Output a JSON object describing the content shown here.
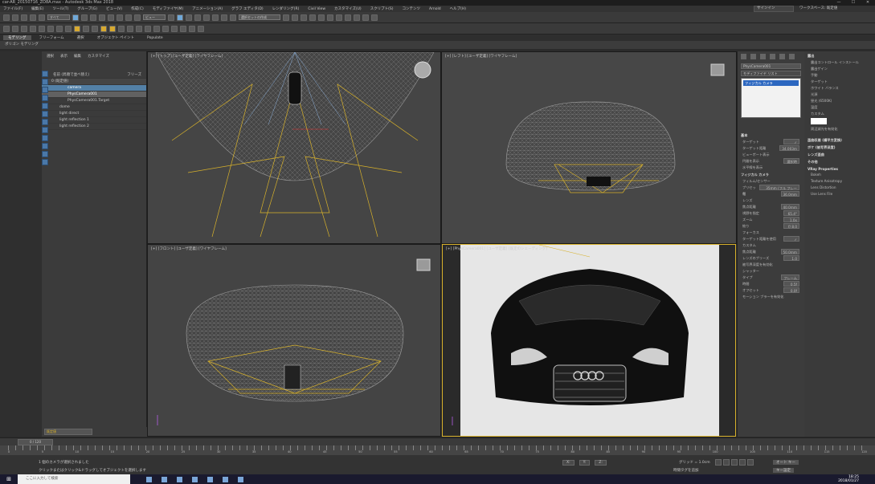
{
  "title_bar": {
    "title": "car-AR_20150716_ZO8A.max - Autodesk 3ds Max 2018",
    "min": "—",
    "max": "☐",
    "close": "✕"
  },
  "menu": {
    "items": [
      "ファイル(F)",
      "編集(E)",
      "ツール(T)",
      "グループ(G)",
      "ビュー(V)",
      "作成(C)",
      "モディファイヤ(M)",
      "アニメーション(A)",
      "グラフ エディタ(D)",
      "レンダリング(R)",
      "Civil View",
      "カスタマイズ(U)",
      "スクリプト(S)",
      "コンテンツ",
      "Arnold",
      "ヘルプ(H)"
    ],
    "signin": "サインイン",
    "workspace": "ワークスペース: 既定値"
  },
  "toolbar1": {
    "selection_filter": "すべて",
    "view_select": "ビュー",
    "named_sel": "選択セットの作成"
  },
  "ribbon": {
    "tabs": [
      "モデリング",
      "フリーフォーム",
      "選択",
      "オブジェクト ペイント",
      "Populate"
    ],
    "sub": "ポリゴン モデリング"
  },
  "scene_explorer": {
    "tabs": [
      "選択",
      "表示",
      "編集",
      "カスタマイズ"
    ],
    "header": "名前 (昇順で並べ替え)",
    "freeze": "フリーズ",
    "rows": [
      {
        "name": "0 (既定値)",
        "sel": false,
        "hdr": true
      },
      {
        "name": "camera",
        "sel": true,
        "hdr": false
      },
      {
        "name": "PhysCamera001",
        "sel": false,
        "hdr": false
      },
      {
        "name": "PhysCamera001.Target",
        "sel": false,
        "hdr": false
      },
      {
        "name": "dome",
        "sel": false,
        "hdr": false
      },
      {
        "name": "light direct",
        "sel": false,
        "hdr": false
      },
      {
        "name": "light reflection 1",
        "sel": false,
        "hdr": false
      },
      {
        "name": "light reflection 2",
        "sel": false,
        "hdr": false
      }
    ],
    "bottom_select": "既定値"
  },
  "viewports": {
    "top": "[+] [トップ] [ユーザ定義] [ワイヤフレーム]",
    "left": "[+] [レフト] [ユーザ定義] [ワイヤフレーム]",
    "front": "[+] [フロント] [ユーザ定義] [ワイヤフレーム]",
    "camera": "[+] [PhysCamera001] [ユーザ定義] [既定のシェーディング]"
  },
  "command_panel": {
    "object_name": "PhysCamera001",
    "modifier_list": "モディファイヤ リスト",
    "stack_item": "フィジカル カメラ",
    "sections": [
      {
        "title": "基本",
        "props": [
          [
            "ターゲット",
            "✓"
          ],
          [
            "ターゲット距離",
            "34.003m"
          ],
          [
            "ビューポート表示",
            ""
          ],
          [
            "円錐を表示",
            "選択時"
          ],
          [
            "水平線を表示",
            ""
          ]
        ]
      },
      {
        "title": "フィジカル カメラ",
        "props": [
          [
            "フィルム/センサー",
            ""
          ],
          [
            "プリセット",
            "35mm (フル フレーム)"
          ],
          [
            "幅",
            "36.0mm"
          ],
          [
            "レンズ",
            ""
          ],
          [
            "焦点距離",
            "40.0mm"
          ],
          [
            "視野を指定",
            "65.4°"
          ],
          [
            "ズーム",
            "1.0x"
          ],
          [
            "絞り",
            "f/ 8.0"
          ],
          [
            "フォーカス",
            ""
          ],
          [
            "ターゲット距離を使用",
            "✓"
          ],
          [
            "カスタム",
            ""
          ],
          [
            "焦点距離",
            "50.0mm"
          ],
          [
            "レンズのブリーズ",
            "1.0"
          ],
          [
            "被写界深度を有効化",
            ""
          ],
          [
            "シャッター",
            ""
          ],
          [
            "タイプ",
            "フレーム"
          ],
          [
            "時間",
            "0.5f"
          ],
          [
            "オフセット",
            "0.0f"
          ],
          [
            "モーション ブラーを有効化",
            ""
          ]
        ]
      }
    ]
  },
  "props_right": {
    "sections": [
      {
        "title": "露出",
        "props": [
          "露出コントロール インストール",
          "露出ゲイン",
          "手動",
          "ターゲット",
          "ホワイト バランス",
          "光源",
          "昼光 (6500K)",
          "温度",
          "カスタム",
          "周辺減光を有効化"
        ]
      },
      {
        "title": "歪曲収差 (横平方変換)",
        "props": []
      },
      {
        "title": "ボケ (被写界深度)",
        "props": []
      },
      {
        "title": "レンズ歪曲",
        "props": []
      },
      {
        "title": "その他",
        "props": []
      },
      {
        "title": "VRay Properties",
        "props": [
          "Bokeh",
          "Texture Anisotropy",
          "Lens Distortion",
          "Use Lens File"
        ]
      }
    ]
  },
  "timeline": {
    "frame": "0 / 120",
    "ticks": [
      "0",
      "5",
      "10",
      "15",
      "20",
      "25",
      "30",
      "35",
      "40",
      "45",
      "50",
      "55",
      "60",
      "65",
      "70",
      "75",
      "80",
      "85",
      "90",
      "95",
      "100",
      "105",
      "110",
      "115",
      "120"
    ]
  },
  "status": {
    "line1": "1 個のカメラが選択されました",
    "line2": "クリックまたはクリック&ドラッグしてオブジェクトを選択します",
    "x": "X:",
    "y": "Y:",
    "z": "Z:",
    "grid": "グリッド = 1.0cm",
    "time_tag": "時間タグを追加",
    "auto_key": "オート キー",
    "set_key": "キー設定"
  },
  "taskbar": {
    "search": "ここに入力して検索",
    "time": "18:25",
    "date": "2018/01/27"
  },
  "colors": {
    "accent": "#d7b12b",
    "selection": "#5380a6",
    "wire": "#8a8a8a"
  }
}
